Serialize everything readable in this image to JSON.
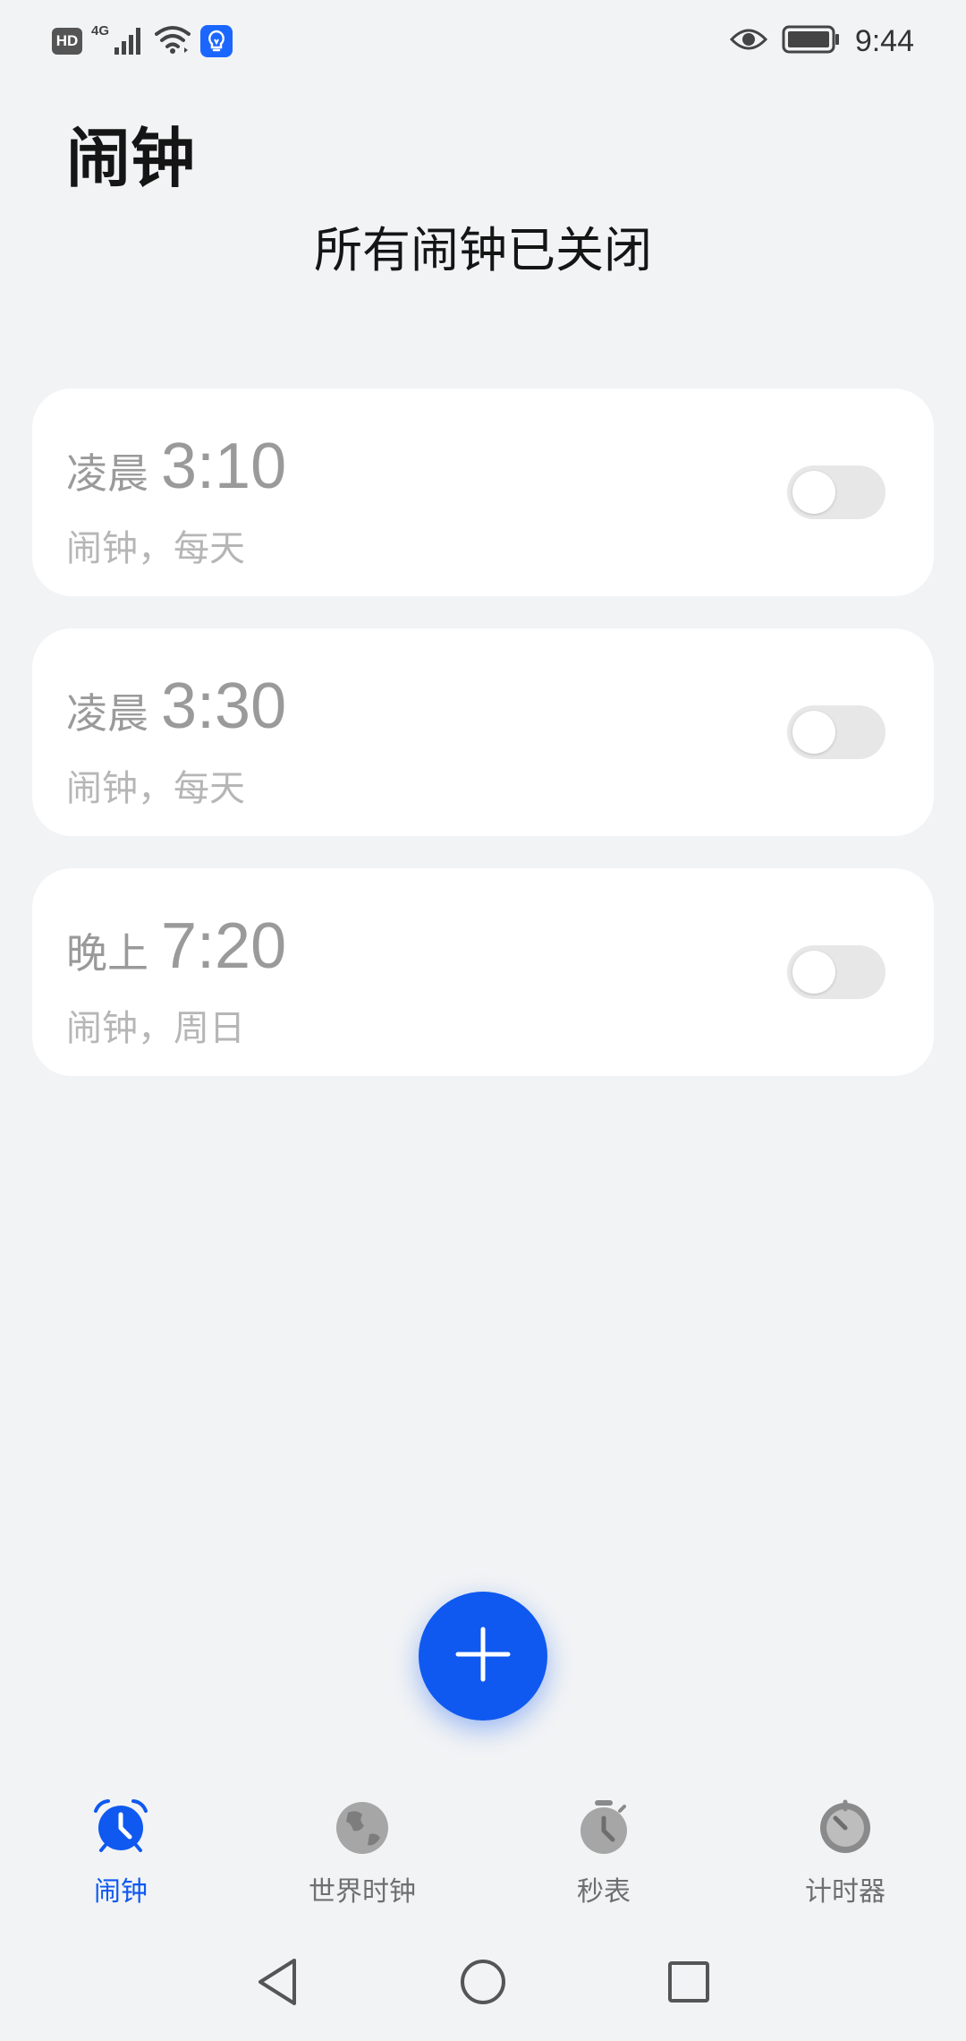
{
  "status_bar": {
    "hd": "HD",
    "network": "4G",
    "time": "9:44"
  },
  "header": {
    "title": "闹钟",
    "summary": "所有闹钟已关闭"
  },
  "alarms": [
    {
      "period": "凌晨",
      "time": "3:10",
      "description": "闹钟，每天",
      "enabled": false
    },
    {
      "period": "凌晨",
      "time": "3:30",
      "description": "闹钟，每天",
      "enabled": false
    },
    {
      "period": "晚上",
      "time": "7:20",
      "description": "闹钟，周日",
      "enabled": false
    }
  ],
  "fab": {
    "icon": "plus-icon"
  },
  "bottom_nav": {
    "active": "alarm",
    "items": [
      {
        "label": "闹钟",
        "icon": "alarm-clock-icon"
      },
      {
        "label": "世界时钟",
        "icon": "globe-icon"
      },
      {
        "label": "秒表",
        "icon": "stopwatch-icon"
      },
      {
        "label": "计时器",
        "icon": "timer-icon"
      }
    ]
  },
  "colors": {
    "accent": "#0f59f0",
    "background": "#f1f3f5",
    "card": "#ffffff",
    "toggle_off": "#e7e7e7",
    "inactive_icon": "#a6a6a6"
  }
}
